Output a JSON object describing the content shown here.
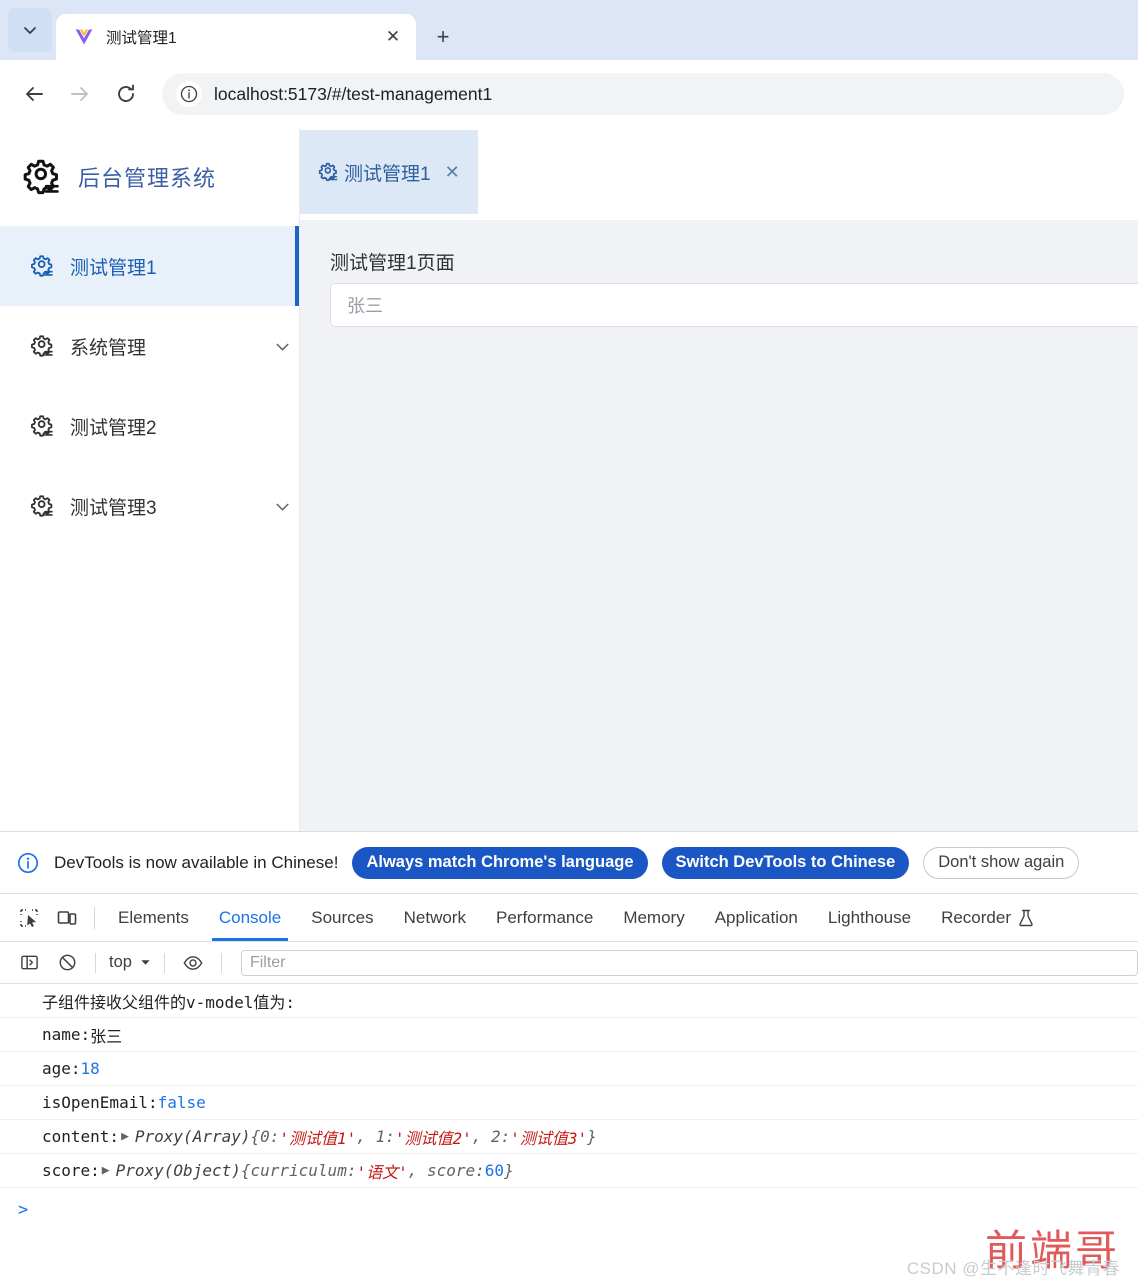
{
  "browser": {
    "tab": {
      "title": "测试管理1",
      "favicon": "vue-logo-icon",
      "close_label": "✕"
    },
    "tablist_icon": "chevron-down-icon",
    "newtab_label": "+",
    "back_icon": "arrow-left-icon",
    "forward_icon": "arrow-right-icon",
    "reload_icon": "reload-icon",
    "site_info_icon": "info-circle-icon",
    "url": "localhost:5173/#/test-management1"
  },
  "app": {
    "brand": {
      "icon": "gear-icon",
      "title": "后台管理系统"
    },
    "sidebar": {
      "items": [
        {
          "label": "测试管理1",
          "icon": "gear-icon",
          "active": true,
          "expandable": false
        },
        {
          "label": "系统管理",
          "icon": "gear-icon",
          "active": false,
          "expandable": true
        },
        {
          "label": "测试管理2",
          "icon": "gear-icon",
          "active": false,
          "expandable": false
        },
        {
          "label": "测试管理3",
          "icon": "gear-icon",
          "active": false,
          "expandable": true
        }
      ]
    },
    "tabstrip": {
      "tabs": [
        {
          "label": "测试管理1",
          "icon": "gear-icon",
          "close_label": "✕",
          "active": true
        }
      ]
    },
    "page": {
      "heading": "测试管理1页面",
      "name_input_value": "张三"
    }
  },
  "devtools": {
    "notice": {
      "icon": "info-circle-icon",
      "text": "DevTools is now available in Chinese!",
      "primary_button": "Always match Chrome's language",
      "secondary_button": "Switch DevTools to Chinese",
      "dismiss_button": "Don't show again"
    },
    "inspect_icon": "inspect-cursor-icon",
    "device_icon": "device-toolbar-icon",
    "tabs": [
      {
        "label": "Elements",
        "active": false
      },
      {
        "label": "Console",
        "active": true
      },
      {
        "label": "Sources",
        "active": false
      },
      {
        "label": "Network",
        "active": false
      },
      {
        "label": "Performance",
        "active": false
      },
      {
        "label": "Memory",
        "active": false
      },
      {
        "label": "Application",
        "active": false
      },
      {
        "label": "Lighthouse",
        "active": false
      },
      {
        "label": "Recorder",
        "active": false,
        "trailing_icon": "flask-icon"
      }
    ],
    "console_toolbar": {
      "sidebar_icon": "console-sidebar-icon",
      "clear_icon": "clear-console-icon",
      "context": "top",
      "context_chevron": "chevron-down-icon",
      "eye_icon": "live-expression-eye-icon",
      "filter_placeholder": "Filter"
    },
    "console_rows": [
      {
        "type": "plain",
        "parts": [
          {
            "t": "plain",
            "v": "子组件接收父组件的v-model值为:"
          }
        ]
      },
      {
        "type": "kv",
        "parts": [
          {
            "t": "plain",
            "v": "name: "
          },
          {
            "t": "plain2",
            "v": "张三"
          }
        ]
      },
      {
        "type": "kv",
        "parts": [
          {
            "t": "plain",
            "v": "age: "
          },
          {
            "t": "num",
            "v": "18"
          }
        ]
      },
      {
        "type": "kv",
        "parts": [
          {
            "t": "plain",
            "v": "isOpenEmail: "
          },
          {
            "t": "bool",
            "v": "false"
          }
        ]
      },
      {
        "type": "obj",
        "parts": [
          {
            "t": "plain",
            "v": "content: "
          },
          {
            "t": "disc",
            "v": "▶"
          },
          {
            "t": "obj",
            "v": "Proxy(Array)"
          },
          {
            "t": "punc",
            "v": " {0: "
          },
          {
            "t": "str",
            "v": "'测试值1'"
          },
          {
            "t": "punc",
            "v": ", 1: "
          },
          {
            "t": "str",
            "v": "'测试值2'"
          },
          {
            "t": "punc",
            "v": ", 2: "
          },
          {
            "t": "str",
            "v": "'测试值3'"
          },
          {
            "t": "punc",
            "v": "}"
          }
        ]
      },
      {
        "type": "obj",
        "parts": [
          {
            "t": "plain",
            "v": "score: "
          },
          {
            "t": "disc",
            "v": "▶"
          },
          {
            "t": "obj",
            "v": "Proxy(Object)"
          },
          {
            "t": "punc",
            "v": " {curriculum: "
          },
          {
            "t": "str",
            "v": "'语文'"
          },
          {
            "t": "punc",
            "v": ", score: "
          },
          {
            "t": "num2",
            "v": "60"
          },
          {
            "t": "punc",
            "v": "}"
          }
        ]
      }
    ],
    "prompt": ">"
  },
  "watermark": {
    "red_text": "前端哥",
    "gray_text": "CSDN @生不逢时飞舞青春"
  },
  "colors": {
    "accent_blue": "#1a73e8",
    "brand_blue": "#3b5ea8",
    "active_bg": "#e8f0f9",
    "devtools_button": "#1a56c4",
    "string_red": "#c41a16",
    "watermark_red": "#e05a5a"
  }
}
